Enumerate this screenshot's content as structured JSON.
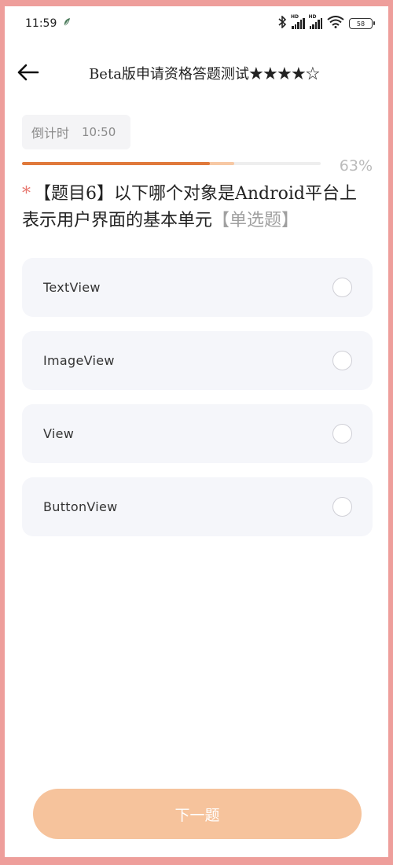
{
  "status_bar": {
    "time": "11:59",
    "notification_icon": "leaf-icon",
    "icons": [
      "bluetooth-icon",
      "signal-hd-icon",
      "signal-hd-icon",
      "wifi-icon"
    ],
    "hd_label": "HD",
    "battery": "58"
  },
  "header": {
    "back_icon": "back-arrow-icon",
    "title": "Beta版申请资格答题测试★★★★☆"
  },
  "countdown": {
    "label": "倒计时",
    "time": "10:50"
  },
  "progress": {
    "percent_text": "63%",
    "fill_fraction": 0.63,
    "buffer_fraction": 0.71
  },
  "question": {
    "required_mark": "*",
    "text": "【题目6】以下哪个对象是Android平台上表示用户界面的基本单元",
    "type": "【单选题】"
  },
  "options": [
    {
      "label": "TextView",
      "selected": false
    },
    {
      "label": "ImageView",
      "selected": false
    },
    {
      "label": "View",
      "selected": false
    },
    {
      "label": "ButtonView",
      "selected": false
    }
  ],
  "next_button": {
    "label": "下一题"
  },
  "colors": {
    "accent": "#e0793b",
    "button": "#f6c39c",
    "option_bg": "#f5f6fa",
    "frame_border": "#ee9e9b"
  }
}
